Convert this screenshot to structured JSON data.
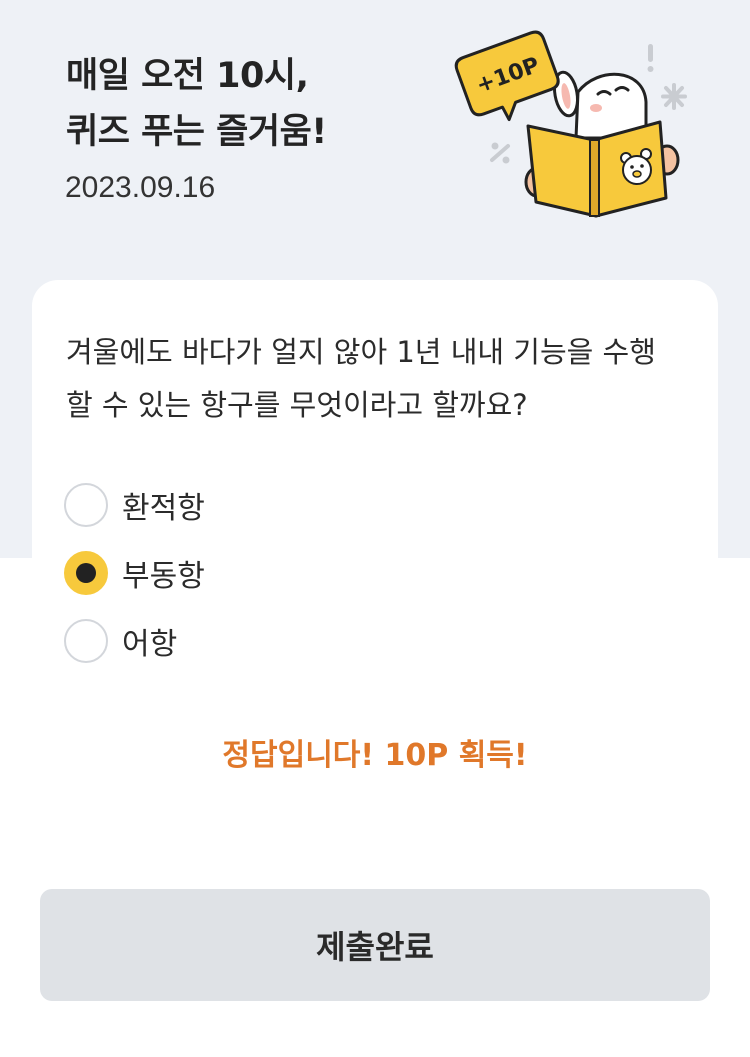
{
  "header": {
    "title_line1": "매일 오전 10시,",
    "title_line2": "퀴즈 푸는 즐거움!",
    "date": "2023.09.16",
    "badge": "+10P"
  },
  "quiz": {
    "question_line1": "겨울에도 바다가 얼지 않아 1년 내내 기능을 수행",
    "question_line2": "할 수 있는 항구를 무엇이라고 할까요?",
    "options": [
      {
        "label": "환적항",
        "selected": false
      },
      {
        "label": "부동항",
        "selected": true
      },
      {
        "label": "어항",
        "selected": false
      }
    ],
    "result_message": "정답입니다! 10P 획득!"
  },
  "submit": {
    "label": "제출완료"
  },
  "colors": {
    "header_bg": "#eef1f6",
    "accent_yellow": "#f7c93c",
    "result_orange": "#e0782a",
    "button_bg": "#dfe2e6"
  },
  "icons": {
    "illustration": "rabbit-reading-book-icon",
    "selected_radio": "radio-selected-icon"
  }
}
